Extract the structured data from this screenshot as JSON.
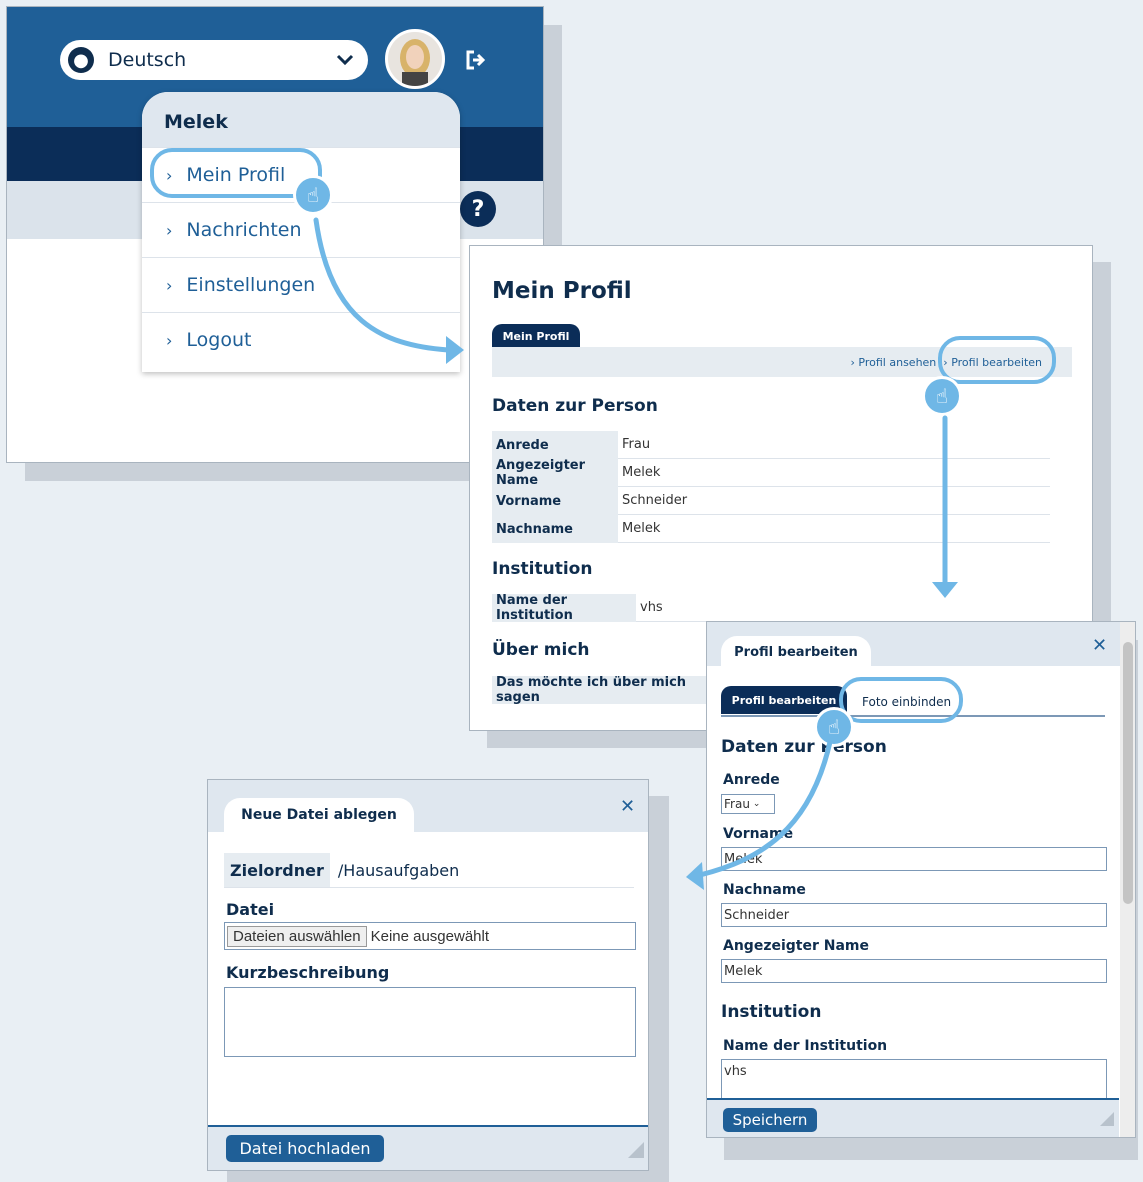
{
  "header": {
    "language": "Deutsch",
    "globe_icon": "globe-icon",
    "chevron_icon": "chevron-down-icon",
    "logout_icon": "logout-icon",
    "help_glyph": "?",
    "colors": {
      "primary": "#1f5f97",
      "dark": "#0b2d58",
      "accent": "#6fb7e6"
    }
  },
  "user_menu": {
    "username": "Melek",
    "items": [
      {
        "label": "Mein Profil"
      },
      {
        "label": "Nachrichten"
      },
      {
        "label": "Einstellungen"
      },
      {
        "label": "Logout"
      }
    ]
  },
  "profile_view": {
    "title": "Mein Profil",
    "tab": "Mein Profil",
    "links": {
      "view": "Profil ansehen",
      "edit": "Profil bearbeiten"
    },
    "section_person": "Daten zur Person",
    "rows": [
      {
        "key": "Anrede",
        "value": "Frau"
      },
      {
        "key": "Angezeigter Name",
        "value": "Melek"
      },
      {
        "key": "Vorname",
        "value": "Schneider"
      },
      {
        "key": "Nachname",
        "value": "Melek"
      }
    ],
    "section_institution": "Institution",
    "institution_row": {
      "key": "Name der Institution",
      "value": "vhs"
    },
    "section_about": "Über mich",
    "about_row": {
      "key": "Das möchte ich über mich sagen",
      "value": ""
    }
  },
  "profile_edit": {
    "dialog_tab": "Profil bearbeiten",
    "close": "✕",
    "subtabs": [
      "Profil bearbeiten",
      "Foto einbinden"
    ],
    "section_person": "Daten zur Person",
    "anrede_label": "Anrede",
    "anrede_value": "Frau",
    "vorname_label": "Vorname",
    "vorname_value": "Melek",
    "nachname_label": "Nachname",
    "nachname_value": "Schneider",
    "anzeige_label": "Angezeigter Name",
    "anzeige_value": "Melek",
    "section_institution": "Institution",
    "institution_label": "Name der Institution",
    "institution_value": "vhs",
    "save_button": "Speichern"
  },
  "upload": {
    "dialog_tab": "Neue Datei ablegen",
    "close": "✕",
    "folder_label": "Zielordner",
    "folder_value": "/Hausaufgaben",
    "file_label": "Datei",
    "choose_button": "Dateien auswählen",
    "no_file": "Keine ausgewählt",
    "desc_label": "Kurzbeschreibung",
    "upload_button": "Datei hochladen"
  }
}
